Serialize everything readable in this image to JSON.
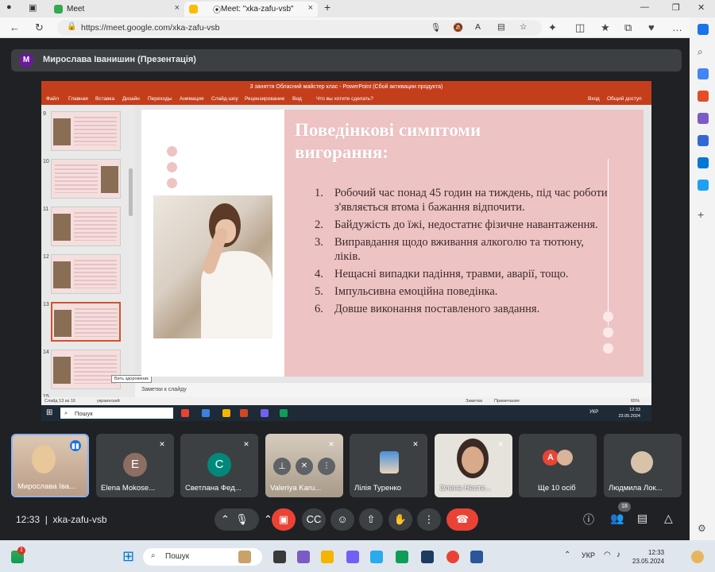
{
  "browser": {
    "tabs": [
      {
        "title": "Meet",
        "active": false
      },
      {
        "title": "Meet: \"xka-zafu-vsb\"",
        "active": true
      }
    ],
    "url": "https://meet.google.com/xka-zafu-vsb"
  },
  "meet": {
    "presenter_initial": "M",
    "presenter_label": "Мирослава Іванишин (Презентація)",
    "time": "12:33",
    "meeting_code": "xka-zafu-vsb",
    "people_count": "18",
    "participants": [
      {
        "name": "Мирослава Іва...",
        "initial": "",
        "color": "#c9a88e",
        "active": true
      },
      {
        "name": "Elena Mokose...",
        "initial": "E",
        "color": "#8d6e63"
      },
      {
        "name": "Светлана Фед...",
        "initial": "С",
        "color": "#00897b"
      },
      {
        "name": "Valeriya Karu...",
        "initial": "",
        "color": "#cfc6b8"
      },
      {
        "name": "Лілія Туренко",
        "initial": "",
        "color": "#5f6368"
      },
      {
        "name": "Олена Несте...",
        "initial": "",
        "color": "#e6e2dc"
      },
      {
        "name": "Ще 10 осіб",
        "initial": "А",
        "color": "#ea4335"
      },
      {
        "name": "Людмила Лок...",
        "initial": "",
        "color": "#5f6368"
      }
    ]
  },
  "ppt": {
    "window_title": "3 заняття Обласний майстер клас - PowerPoint (Сбой активации продукта)",
    "ribbon": [
      "Файл",
      "Главная",
      "Вставка",
      "Дизайн",
      "Переходы",
      "Анимация",
      "Слайд-шоу",
      "Рецензирование",
      "Вид",
      "Что вы хотите сделать?",
      "Вход",
      "Общий доступ"
    ],
    "thumb_numbers": [
      "9",
      "10",
      "11",
      "12",
      "13",
      "14",
      "15"
    ],
    "slide": {
      "title": "Поведінкові симптоми вигорання:",
      "items": [
        {
          "n": "1.",
          "text": "Робочий час понад 45 годин на  тиждень, під час роботи з'являється втома і бажання відпочити."
        },
        {
          "n": "2.",
          "text": "Байдужість до їжі, недостатнє фізичне навантаження."
        },
        {
          "n": "3.",
          "text": "Виправдання щодо вживання алкоголю та тютюну, ліків."
        },
        {
          "n": "4.",
          "text": "Нещасні випадки падіння, травми, аварії, тощо."
        },
        {
          "n": "5.",
          "text": "Імпульсивна емоційна поведінка."
        },
        {
          "n": "6.",
          "text": "Довше виконання поставленого завдання."
        }
      ]
    },
    "notes": "Заметки к слайду",
    "tooltip": "Вить здоровяник",
    "status_slide": "Слайд 13 из 16",
    "status_lang": "украинский",
    "status_notes": "Заметки",
    "status_comments": "Примечания",
    "status_zoom": "65%",
    "taskbar_search": "Пошук",
    "clock_time": "12:33",
    "clock_date": "23.05.2024",
    "lang": "УКР"
  },
  "windows": {
    "search": "Пошук",
    "lang": "УКР",
    "time": "12:33",
    "date": "23.05.2024"
  }
}
